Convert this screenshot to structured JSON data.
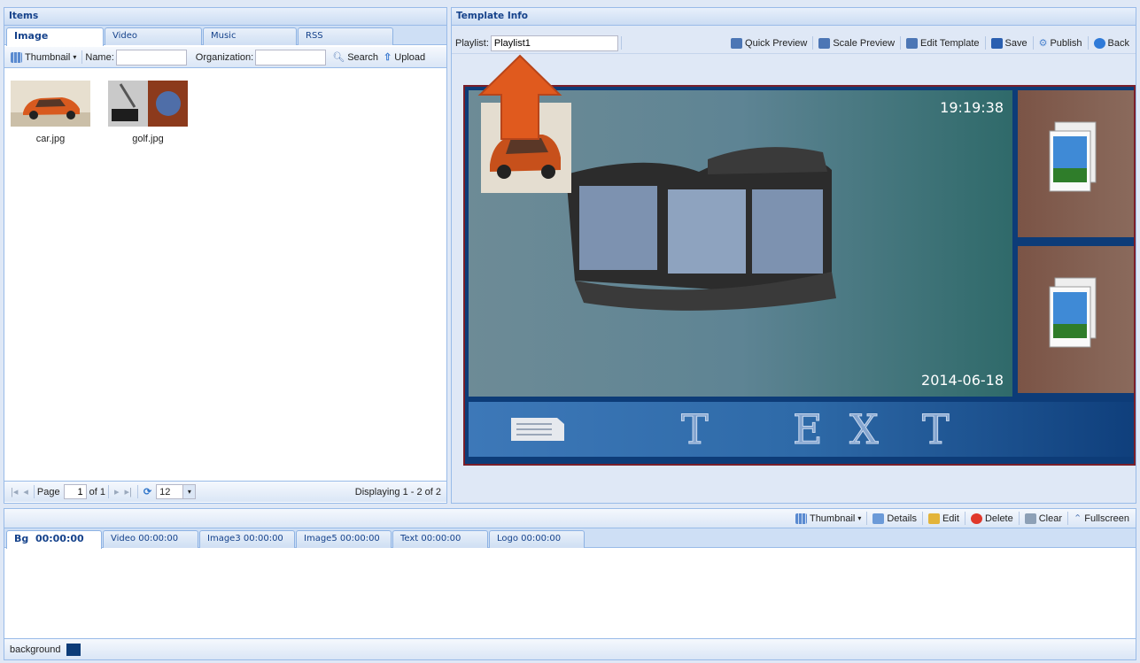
{
  "items_panel": {
    "title": "Items",
    "tabs": [
      "Image",
      "Video",
      "Music",
      "RSS"
    ],
    "toolbar": {
      "view_label": "Thumbnail",
      "name_label": "Name:",
      "name_value": "",
      "org_label": "Organization:",
      "org_value": "",
      "search_label": "Search",
      "upload_label": "Upload"
    },
    "files": [
      {
        "name": "car.jpg",
        "icon": "car-thumbnail"
      },
      {
        "name": "golf.jpg",
        "icon": "golf-thumbnail"
      }
    ],
    "pager": {
      "page_label": "Page",
      "page_value": "1",
      "of_label": "of 1",
      "page_size": "12",
      "display_text": "Displaying 1 - 2 of 2"
    }
  },
  "template_panel": {
    "title": "Template Info",
    "playlist_label": "Playlist:",
    "playlist_value": "Playlist1",
    "actions": [
      "Quick Preview",
      "Scale Preview",
      "Edit Template",
      "Save",
      "Publish",
      "Back"
    ],
    "preview": {
      "time": "19:19:38",
      "date": "2014-06-18",
      "banner_letters": [
        "T",
        "E",
        "X",
        "T"
      ]
    }
  },
  "bottom_panel": {
    "toolbar": [
      "Thumbnail",
      "Details",
      "Edit",
      "Delete",
      "Clear",
      "Fullscreen"
    ],
    "tabs": [
      {
        "label": "Bg",
        "time": "00:00:00"
      },
      {
        "label": "Video",
        "time": "00:00:00"
      },
      {
        "label": "Image3",
        "time": "00:00:00"
      },
      {
        "label": "Image5",
        "time": "00:00:00"
      },
      {
        "label": "Text",
        "time": "00:00:00"
      },
      {
        "label": "Logo",
        "time": "00:00:00"
      }
    ],
    "status_label": "background",
    "status_color": "#0d3c78"
  },
  "colors": {
    "accent": "#15428b",
    "preview_bg": "#0d3c78",
    "arrow": "#e05a1e"
  }
}
